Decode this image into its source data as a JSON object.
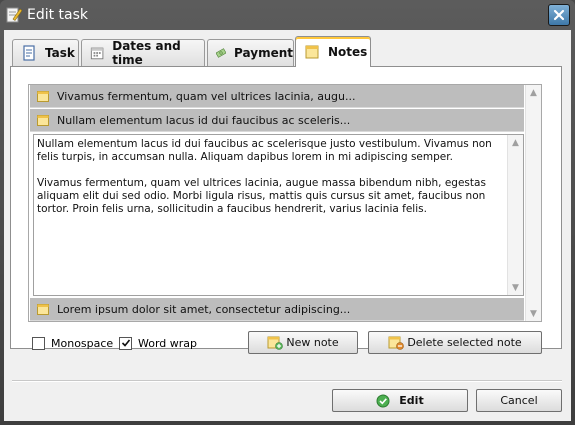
{
  "window": {
    "title": "Edit task"
  },
  "tabs": [
    {
      "label": "Task",
      "icon": "task-icon"
    },
    {
      "label": "Dates and time",
      "icon": "calendar-icon"
    },
    {
      "label": "Payment",
      "icon": "money-icon"
    },
    {
      "label": "Notes",
      "icon": "note-icon",
      "active": true
    }
  ],
  "notes": [
    {
      "title": "Vivamus fermentum, quam vel ultrices lacinia, augu..."
    },
    {
      "title": "Nullam elementum lacus id dui faucibus ac sceleris...",
      "expanded": true,
      "body": "Nullam elementum lacus id dui faucibus ac scelerisque justo vestibulum. Vivamus non felis turpis, in accumsan nulla. Aliquam dapibus lorem in mi adipiscing semper.\n\nVivamus fermentum, quam vel ultrices lacinia, augue massa bibendum nibh, egestas aliquam elit dui sed odio. Morbi ligula risus, mattis quis cursus sit amet, faucibus non tortor. Proin felis urna, sollicitudin a faucibus hendrerit, varius lacinia felis."
    },
    {
      "title": "Lorem ipsum dolor sit amet, consectetur adipiscing..."
    }
  ],
  "options": {
    "monospace": {
      "label": "Monospace",
      "checked": false
    },
    "word_wrap": {
      "label": "Word wrap",
      "checked": true
    }
  },
  "buttons": {
    "new_note": "New note",
    "delete_note": "Delete selected note",
    "edit": "Edit",
    "cancel": "Cancel"
  },
  "colors": {
    "titlebar": "#4a4a4a",
    "note_header": "#bdbdbd",
    "active_tab_accent": "#ffc83d",
    "edit_icon": "#3aa53a"
  }
}
